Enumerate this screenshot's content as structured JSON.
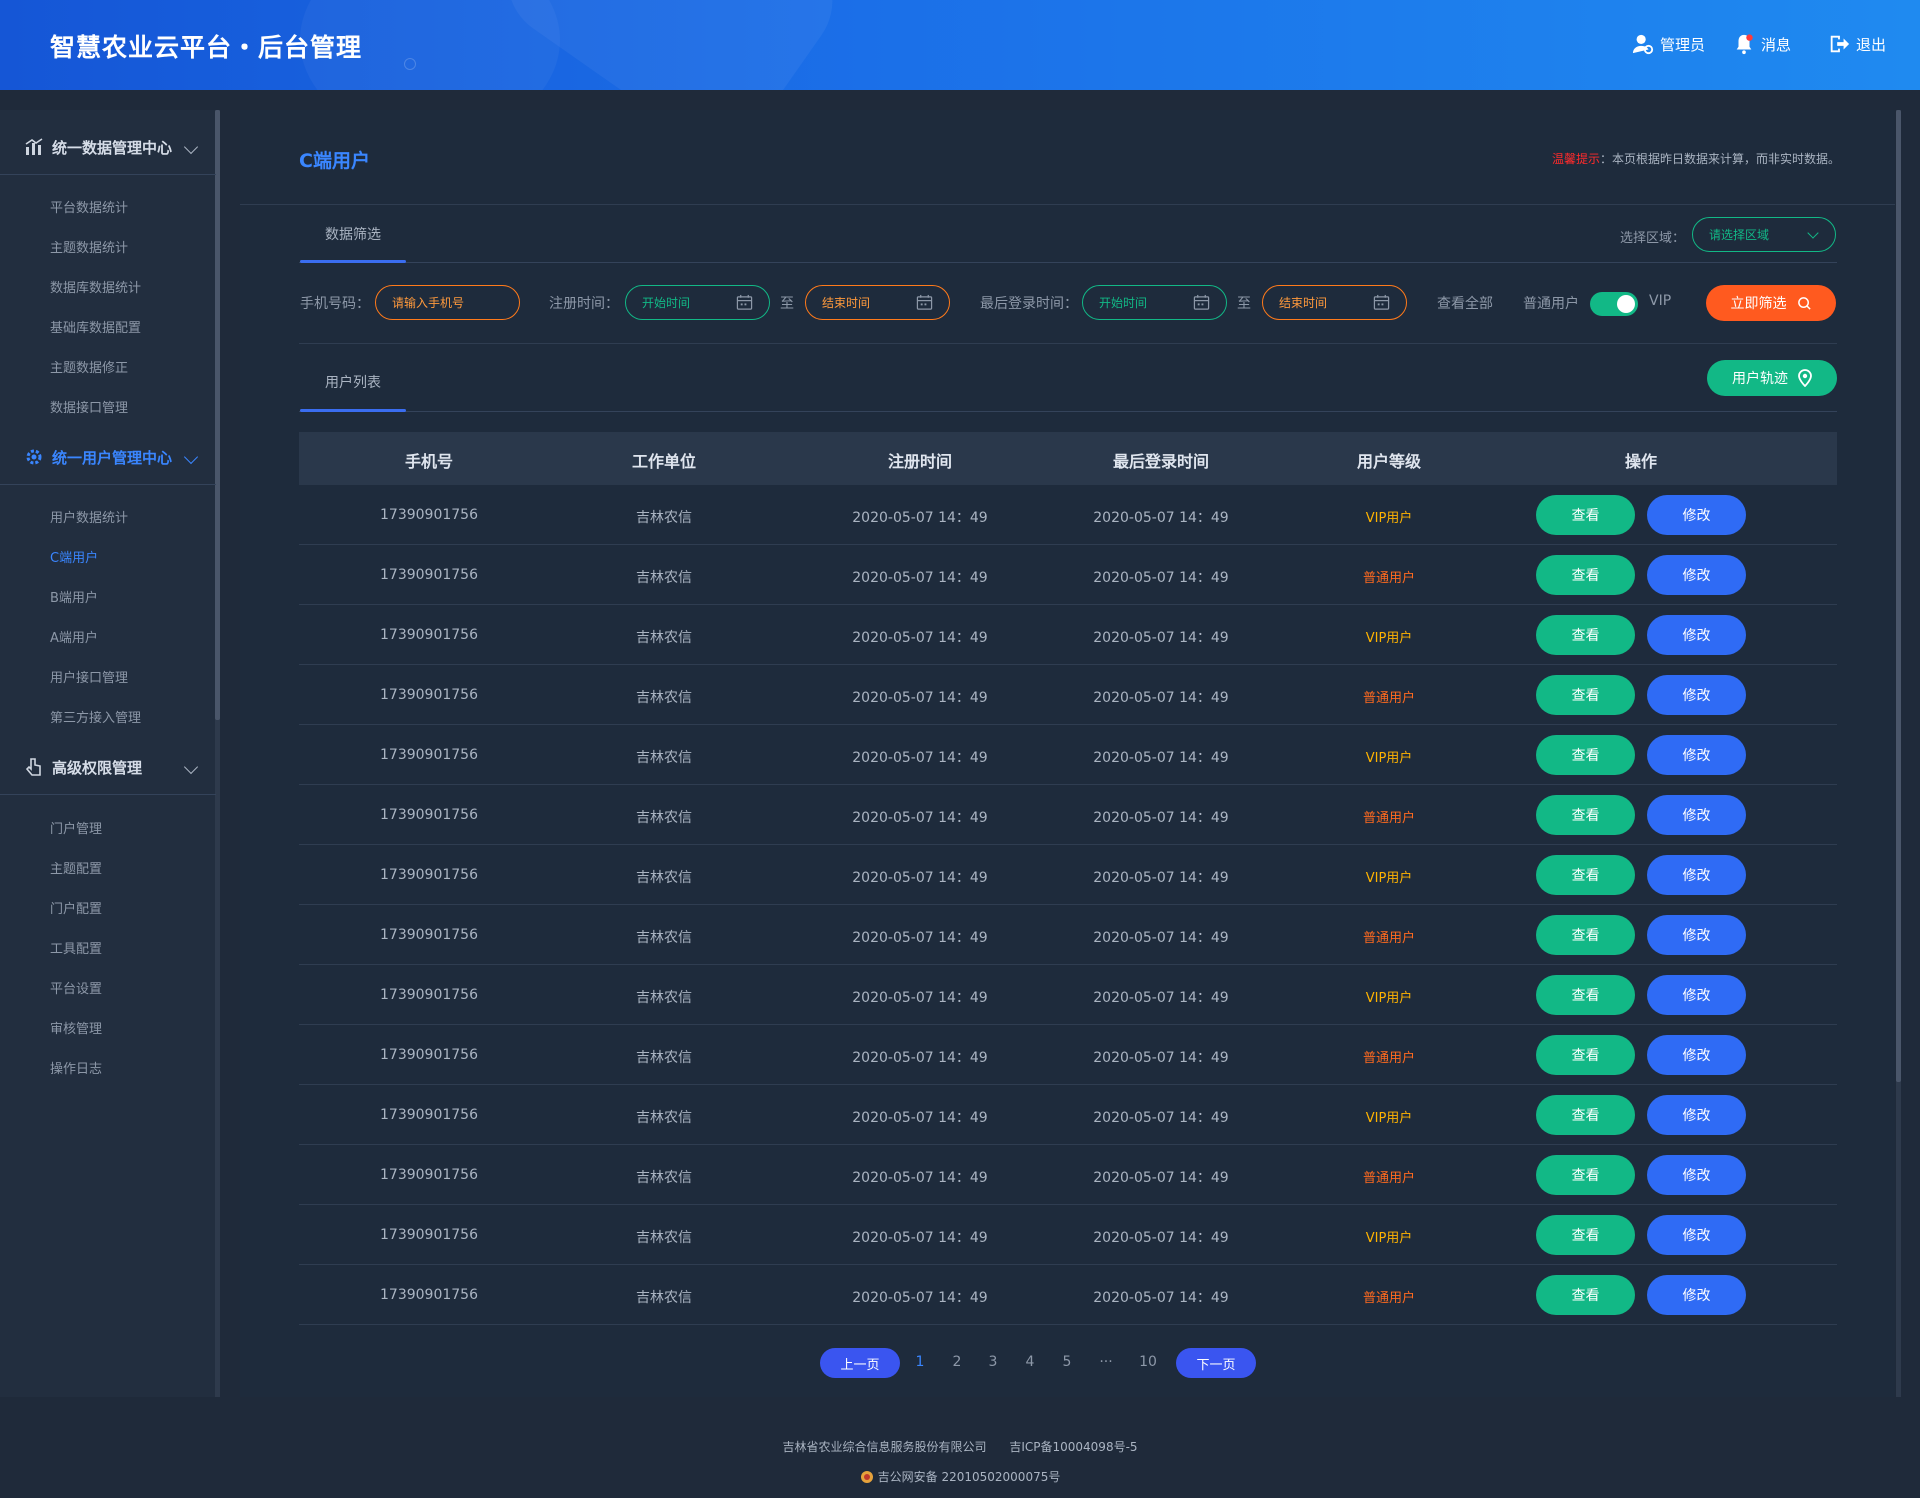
{
  "header": {
    "title": "智慧农业云平台・后台管理",
    "admin_label": "管理员",
    "messages_label": "消息",
    "logout_label": "退出"
  },
  "sidebar": {
    "groups": [
      {
        "label": "统一数据管理中心",
        "icon": "chart-icon",
        "items": [
          "平台数据统计",
          "主题数据统计",
          "数据库数据统计",
          "基础库数据配置",
          "主题数据修正",
          "数据接口管理"
        ]
      },
      {
        "label": "统一用户管理中心",
        "icon": "gear-icon",
        "items": [
          "用户数据统计",
          "C端用户",
          "B端用户",
          "A端用户",
          "用户接口管理",
          "第三方接入管理"
        ]
      },
      {
        "label": "高级权限管理",
        "icon": "hand-pointer-icon",
        "items": [
          "门户管理",
          "主题配置",
          "门户配置",
          "工具配置",
          "平台设置",
          "审核管理",
          "操作日志"
        ]
      }
    ],
    "active_item": "C端用户"
  },
  "page": {
    "title": "C端用户",
    "notice_warn": "温馨提示",
    "notice_text": "：本页根据昨日数据来计算，而非实时数据。"
  },
  "filter": {
    "tab": "数据筛选",
    "region_label": "选择区域：",
    "region_placeholder": "请选择区域",
    "phone_label": "手机号码：",
    "phone_placeholder": "请输入手机号",
    "reg_label": "注册时间：",
    "login_label": "最后登录时间：",
    "start_placeholder": "开始时间",
    "end_placeholder": "结束时间",
    "to": "至",
    "view_all": "查看全部",
    "normal_user": "普通用户",
    "vip": "VIP",
    "submit": "立即筛选"
  },
  "list": {
    "tab": "用户列表",
    "track_button": "用户轨迹",
    "columns": [
      "手机号",
      "工作单位",
      "注册时间",
      "最后登录时间",
      "用户等级",
      "操作"
    ],
    "view_label": "查看",
    "edit_label": "修改",
    "rows": [
      {
        "phone": "17390901756",
        "org": "吉林农信",
        "reg": "2020-05-07  14：49",
        "login": "2020-05-07  14：49",
        "level": "VIP用户"
      },
      {
        "phone": "17390901756",
        "org": "吉林农信",
        "reg": "2020-05-07  14：49",
        "login": "2020-05-07  14：49",
        "level": "普通用户"
      },
      {
        "phone": "17390901756",
        "org": "吉林农信",
        "reg": "2020-05-07  14：49",
        "login": "2020-05-07  14：49",
        "level": "VIP用户"
      },
      {
        "phone": "17390901756",
        "org": "吉林农信",
        "reg": "2020-05-07  14：49",
        "login": "2020-05-07  14：49",
        "level": "普通用户"
      },
      {
        "phone": "17390901756",
        "org": "吉林农信",
        "reg": "2020-05-07  14：49",
        "login": "2020-05-07  14：49",
        "level": "VIP用户"
      },
      {
        "phone": "17390901756",
        "org": "吉林农信",
        "reg": "2020-05-07  14：49",
        "login": "2020-05-07  14：49",
        "level": "普通用户"
      },
      {
        "phone": "17390901756",
        "org": "吉林农信",
        "reg": "2020-05-07  14：49",
        "login": "2020-05-07  14：49",
        "level": "VIP用户"
      },
      {
        "phone": "17390901756",
        "org": "吉林农信",
        "reg": "2020-05-07  14：49",
        "login": "2020-05-07  14：49",
        "level": "普通用户"
      },
      {
        "phone": "17390901756",
        "org": "吉林农信",
        "reg": "2020-05-07  14：49",
        "login": "2020-05-07  14：49",
        "level": "VIP用户"
      },
      {
        "phone": "17390901756",
        "org": "吉林农信",
        "reg": "2020-05-07  14：49",
        "login": "2020-05-07  14：49",
        "level": "普通用户"
      },
      {
        "phone": "17390901756",
        "org": "吉林农信",
        "reg": "2020-05-07  14：49",
        "login": "2020-05-07  14：49",
        "level": "VIP用户"
      },
      {
        "phone": "17390901756",
        "org": "吉林农信",
        "reg": "2020-05-07  14：49",
        "login": "2020-05-07  14：49",
        "level": "普通用户"
      },
      {
        "phone": "17390901756",
        "org": "吉林农信",
        "reg": "2020-05-07  14：49",
        "login": "2020-05-07  14：49",
        "level": "VIP用户"
      },
      {
        "phone": "17390901756",
        "org": "吉林农信",
        "reg": "2020-05-07  14：49",
        "login": "2020-05-07  14：49",
        "level": "普通用户"
      }
    ]
  },
  "pagination": {
    "prev": "上一页",
    "next": "下一页",
    "pages": [
      "1",
      "2",
      "3",
      "4",
      "5",
      "···",
      "10"
    ],
    "current": "1"
  },
  "footer": {
    "company": "吉林省农业综合信息服务股份有限公司",
    "icp": "吉ICP备10004098号-5",
    "police": "吉公网安备 22010502000075号"
  },
  "colors": {
    "accent": "#3a86ff",
    "green": "#12b886",
    "orange": "#ff5a1f",
    "vip": "#ffb300",
    "normal": "#ff6a1f"
  }
}
